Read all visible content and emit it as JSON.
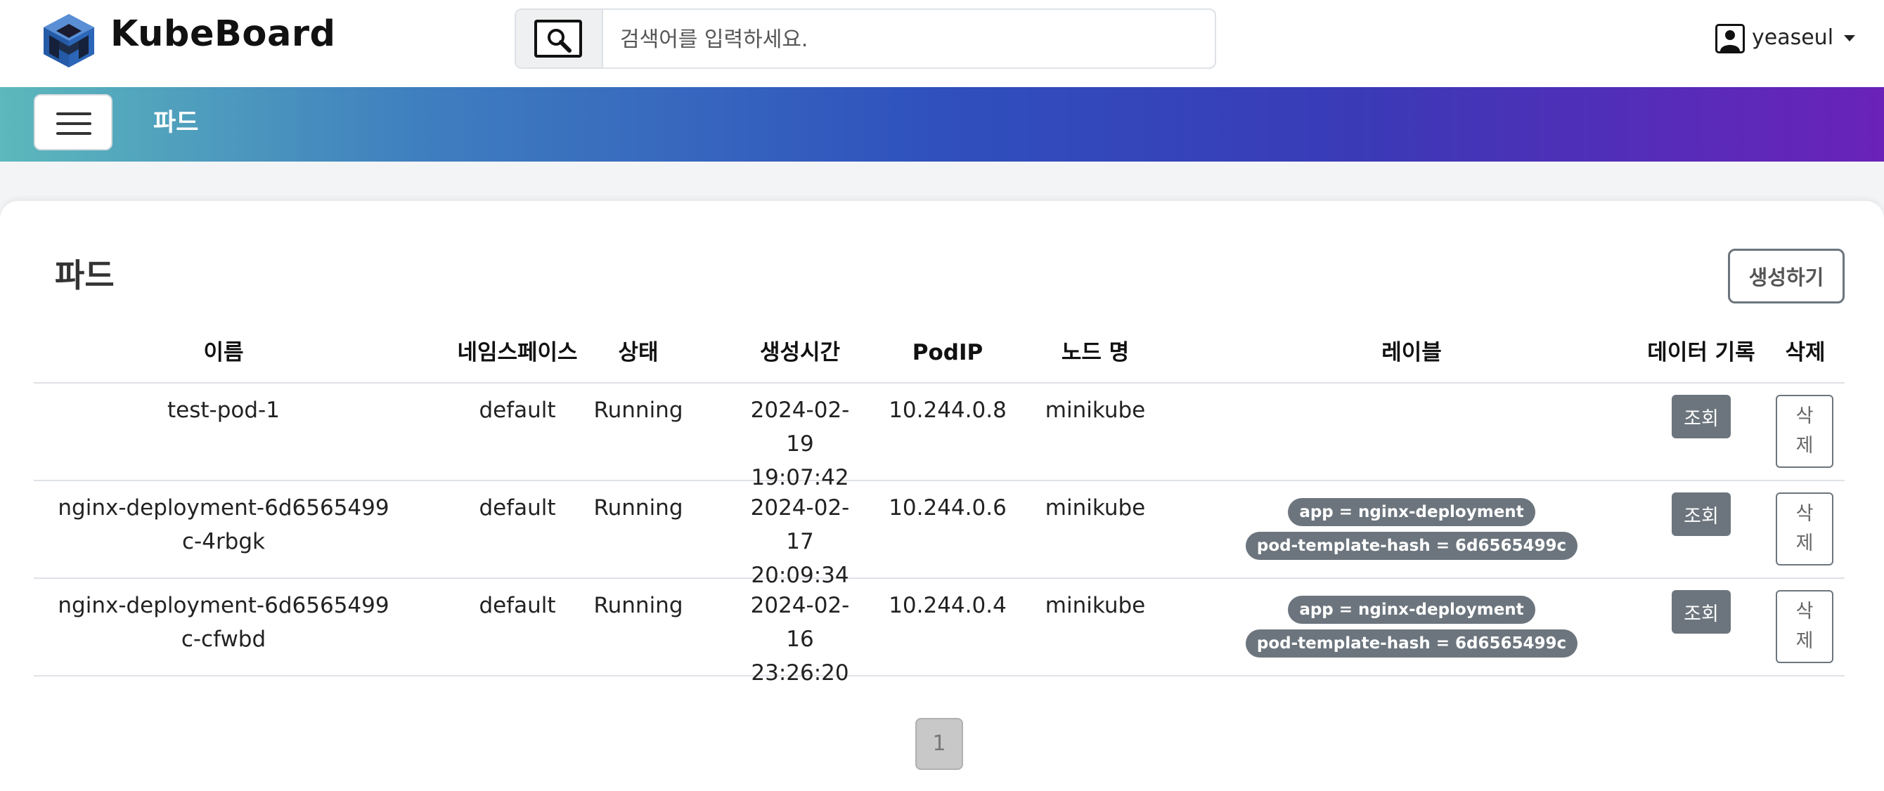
{
  "app": {
    "brand": "KubeBoard"
  },
  "search": {
    "placeholder": "검색어를 입력하세요."
  },
  "user": {
    "name": "yeaseul"
  },
  "header": {
    "title": "파드"
  },
  "main": {
    "title": "파드",
    "create_label": "생성하기",
    "columns": [
      "이름",
      "네임스페이스",
      "상태",
      "생성시간",
      "PodIP",
      "노드 명",
      "레이블",
      "데이터 기록",
      "삭제"
    ],
    "rows": [
      {
        "name": "test-pod-1",
        "namespace": "default",
        "status": "Running",
        "created": "2024-02-19 19:07:42",
        "ip": "10.244.0.8",
        "node": "minikube",
        "labels": [],
        "view": "조회",
        "delete": "삭제"
      },
      {
        "name": "nginx-deployment-6d6565499c-4rbgk",
        "namespace": "default",
        "status": "Running",
        "created": "2024-02-17 20:09:34",
        "ip": "10.244.0.6",
        "node": "minikube",
        "labels": [
          "app = nginx-deployment",
          "pod-template-hash = 6d6565499c"
        ],
        "view": "조회",
        "delete": "삭제"
      },
      {
        "name": "nginx-deployment-6d6565499c-cfwbd",
        "namespace": "default",
        "status": "Running",
        "created": "2024-02-16 23:26:20",
        "ip": "10.244.0.4",
        "node": "minikube",
        "labels": [
          "app = nginx-deployment",
          "pod-template-hash = 6d6565499c"
        ],
        "view": "조회",
        "delete": "삭제"
      }
    ]
  },
  "pagination": {
    "current": "1"
  },
  "icons": {
    "logo": "cube-logo-icon",
    "search": "magnifier-icon",
    "user": "user-avatar-icon",
    "menu": "hamburger-icon"
  },
  "colors": {
    "gradient_start": "#5cb8bc",
    "gradient_mid": "#2f50bd",
    "gradient_end": "#6a22b8",
    "badge": "#6c757d"
  }
}
